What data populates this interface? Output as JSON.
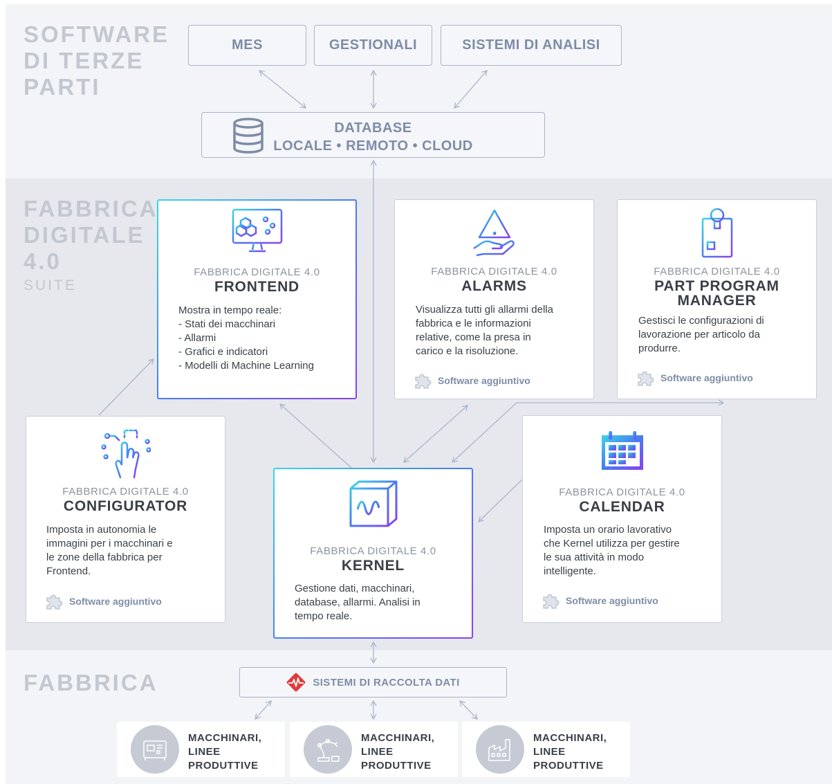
{
  "sections": {
    "third_party": [
      "SOFTWARE",
      "DI TERZE",
      "PARTI"
    ],
    "suite": [
      "FABBRICA",
      "DIGITALE",
      "4.0"
    ],
    "suite_sub": "SUITE",
    "factory": "FABBRICA"
  },
  "third_party_boxes": [
    "MES",
    "GESTIONALI",
    "SISTEMI DI ANALISI"
  ],
  "database": {
    "line1": "DATABASE",
    "line2": "LOCALE • REMOTO • CLOUD"
  },
  "suite_prefix": "FABBRICA DIGITALE 4.0",
  "addon_label": "Software aggiuntivo",
  "modules": {
    "frontend": {
      "name": "FRONTEND",
      "desc": [
        "Mostra in tempo reale:",
        " - Stati dei macchinari",
        " - Allarmi",
        " - Grafici e indicatori",
        " - Modelli di Machine Learning"
      ]
    },
    "alarms": {
      "name": "ALARMS",
      "desc": [
        "Visualizza tutti gli allarmi della",
        "fabbrica e le informazioni",
        "relative, come la presa in",
        "carico e la risoluzione."
      ]
    },
    "ppm": {
      "name": [
        "PART PROGRAM",
        "MANAGER"
      ],
      "desc": [
        "Gestisci le configurazioni di",
        "lavorazione per articolo da",
        "produrre."
      ]
    },
    "configurator": {
      "name": "CONFIGURATOR",
      "desc": [
        "Imposta in autonomia le",
        "immagini per i macchinari e",
        "le zone della fabbrica per",
        "Frontend."
      ]
    },
    "kernel": {
      "name": "KERNEL",
      "desc": [
        "Gestione dati, macchinari,",
        "database, allarmi. Analisi in",
        "tempo reale."
      ]
    },
    "calendar": {
      "name": "CALENDAR",
      "desc": [
        "Imposta un orario lavorativo",
        "che Kernel utilizza per gestire",
        "le sua attività in modo",
        "intelligente."
      ]
    }
  },
  "data_collection": "SISTEMI DI RACCOLTA DATI",
  "machines": [
    {
      "lines": [
        "MACCHINARI,",
        "LINEE",
        "PRODUTTIVE"
      ],
      "icon": "control-panel-icon"
    },
    {
      "lines": [
        "MACCHINARI,",
        "LINEE",
        "PRODUTTIVE"
      ],
      "icon": "robot-arm-icon"
    },
    {
      "lines": [
        "MACCHINARI,",
        "LINEE",
        "PRODUTTIVE"
      ],
      "icon": "factory-icon"
    }
  ],
  "colors": {
    "accent_cyan": "#3ad6e6",
    "accent_blue": "#4a7cf0",
    "accent_purple": "#8a3ff0",
    "alert_red": "#e23b3b"
  }
}
